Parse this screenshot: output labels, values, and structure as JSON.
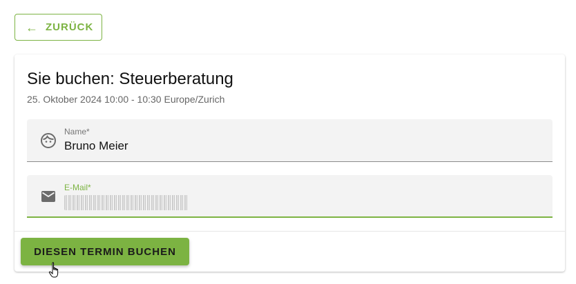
{
  "back": {
    "arrow": "←",
    "label": "ZURÜCK"
  },
  "card": {
    "title": "Sie buchen: Steuerberatung",
    "subtitle": "25. Oktober 2024 10:00 - 10:30 Europe/Zurich"
  },
  "fields": {
    "name": {
      "label": "Name*",
      "value": "Bruno Meier",
      "icon": "face-icon"
    },
    "email": {
      "label": "E-Mail*",
      "value": "",
      "icon": "mail-icon"
    }
  },
  "submit": {
    "label": "DIESEN TERMIN BUCHEN"
  },
  "colors": {
    "accent": "#7cb342",
    "field_bg": "#f3f3f3"
  }
}
